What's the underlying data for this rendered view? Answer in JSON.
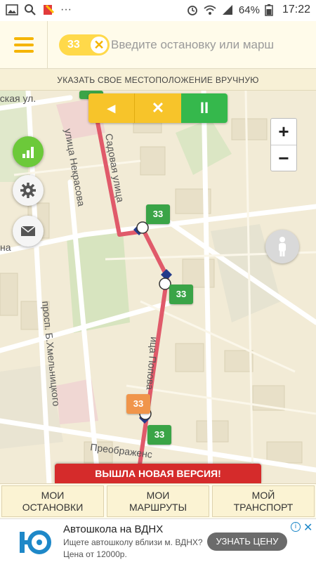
{
  "status_bar": {
    "battery": "64%",
    "time": "17:22",
    "more": "···"
  },
  "header": {
    "route_number": "33",
    "search_placeholder": "Введите остановку или марш"
  },
  "manual_location": "УКАЗАТЬ СВОЕ МЕСТОПОЛОЖЕНИЕ ВРУЧНУЮ",
  "map": {
    "streets": [
      "еская ул.",
      "улица Некрасова",
      "Садовая улица",
      "на",
      "ица Попова",
      "просп. Б.Хмельницкого",
      "Преображенс"
    ],
    "badges": [
      "33",
      "33",
      "33",
      "33",
      "33"
    ]
  },
  "playback": {
    "back": "◂",
    "stop": "✕",
    "pause": "II"
  },
  "zoom": {
    "in": "+",
    "out": "−"
  },
  "banner": "ВЫШЛА НОВАЯ ВЕРСИЯ!",
  "bottom_nav": [
    {
      "label": "МОИ\nОСТАНОВКИ"
    },
    {
      "label": "МОИ\nМАРШРУТЫ"
    },
    {
      "label": "МОЙ\nТРАНСПОРТ"
    }
  ],
  "ad": {
    "title": "Автошкола на ВДНХ",
    "line1": "Ищете автошколу вблизи м. ВДНХ?",
    "line2": "Цена от 12000р.",
    "cta": "УЗНАТЬ ЦЕНУ"
  },
  "colors": {
    "accent": "#f5b400",
    "route": "#e05a6a",
    "badge_green": "#3aa447",
    "badge_orange": "#f0954b",
    "banner_red": "#d52b2b"
  }
}
